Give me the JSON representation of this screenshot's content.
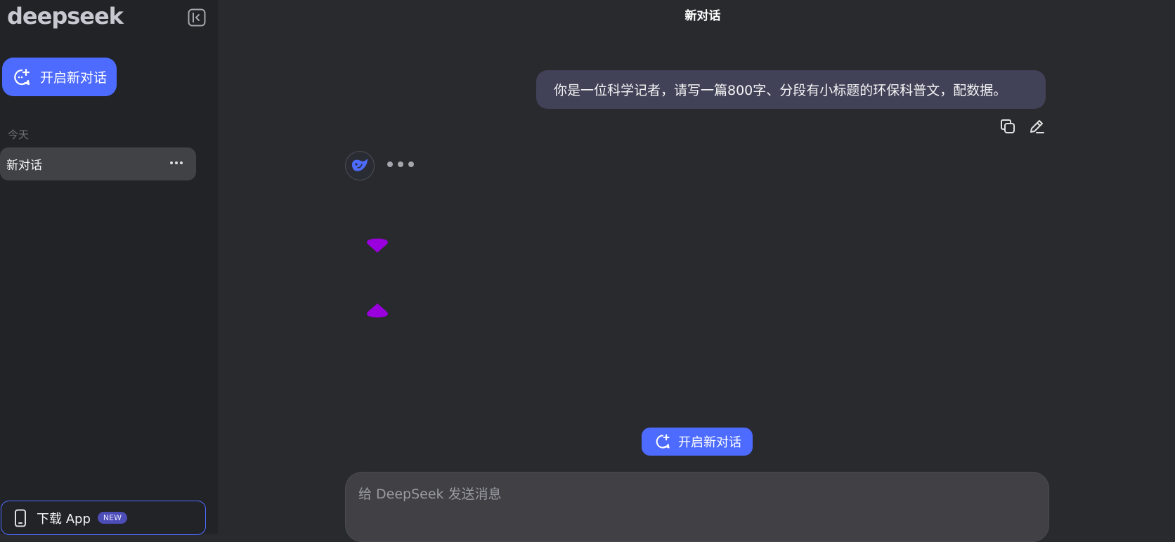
{
  "sidebar": {
    "logo": "deepseek",
    "new_chat_label": "开启新对话",
    "section_today": "今天",
    "conversations": [
      {
        "label": "新对话"
      }
    ],
    "download_label": "下载 App",
    "download_badge": "NEW"
  },
  "header": {
    "title": "新对话"
  },
  "messages": {
    "user_text": "你是一位科学记者，请写一篇800字、分段有小标题的环保科普文，配数据。"
  },
  "main": {
    "new_chat_label": "开启新对话"
  },
  "composer": {
    "placeholder": "给 DeepSeek 发送消息"
  },
  "colors": {
    "accent": "#4d6bfe",
    "magenta": "#9900dd",
    "sidebar_bg": "#212327",
    "main_bg": "#292a2d"
  },
  "icons": [
    "new-chat-icon",
    "sidebar-collapse-icon",
    "more-icon",
    "phone-icon",
    "copy-icon",
    "edit-icon",
    "deepseek-whale-icon"
  ]
}
